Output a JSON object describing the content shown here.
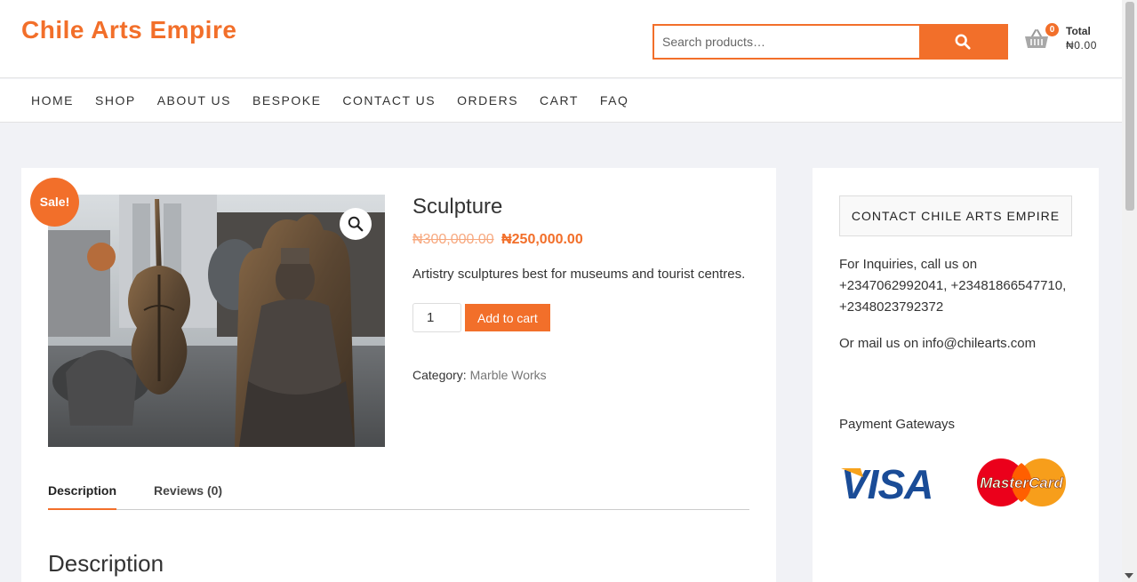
{
  "site": {
    "name": "Chile Arts Empire"
  },
  "search": {
    "placeholder": "Search products…"
  },
  "cart": {
    "count": "0",
    "total_label": "Total",
    "total_value": "₦0.00"
  },
  "nav": [
    "HOME",
    "SHOP",
    "ABOUT US",
    "BESPOKE",
    "CONTACT US",
    "ORDERS",
    "CART",
    "FAQ"
  ],
  "product": {
    "sale_badge": "Sale!",
    "title": "Sculpture",
    "old_price": "₦300,000.00",
    "new_price": "₦250,000.00",
    "short_description": "Artistry sculptures best for museums and tourist centres.",
    "quantity": "1",
    "add_to_cart_label": "Add to cart",
    "category_label": "Category:",
    "category_value": "Marble Works"
  },
  "tabs": [
    "Description",
    "Reviews (0)"
  ],
  "description_heading": "Description",
  "sidebar": {
    "widget_title": "CONTACT CHILE ARTS EMPIRE",
    "contact_text": "For Inquiries, call us on +2347062992041, +23481866547710, +2348023792372",
    "mail_text": "Or mail us on info@chilearts.com",
    "payment_label": "Payment Gateways",
    "visa_text": "VISA",
    "mastercard_text": "MasterCard"
  },
  "colors": {
    "accent": "#f26f2a",
    "visa_blue": "#1a4c97",
    "visa_gold": "#f7a21b",
    "mc_red": "#eb001b",
    "mc_yellow": "#f79e1b"
  },
  "icons": {
    "search": "search-icon",
    "cart": "basket-icon",
    "zoom": "zoom-icon"
  }
}
